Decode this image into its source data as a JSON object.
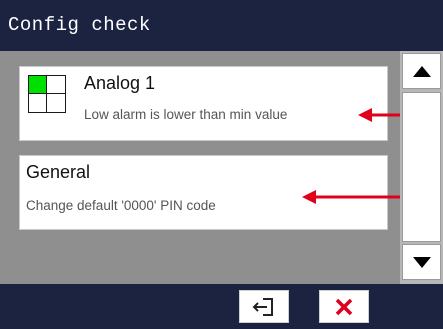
{
  "header": {
    "title": "Config check"
  },
  "items": [
    {
      "title": "Analog 1",
      "description": "Low alarm is lower than min value",
      "icon": "analog-grid-icon"
    },
    {
      "title": "General",
      "description": "Change default '0000' PIN code"
    }
  ],
  "colors": {
    "header_bg": "#1b2340",
    "accent_green": "#00e000",
    "arrow_red": "#e0001b",
    "close_red": "#e0001b"
  },
  "footer": {
    "exit_icon": "exit-icon",
    "close_icon": "close-icon"
  }
}
